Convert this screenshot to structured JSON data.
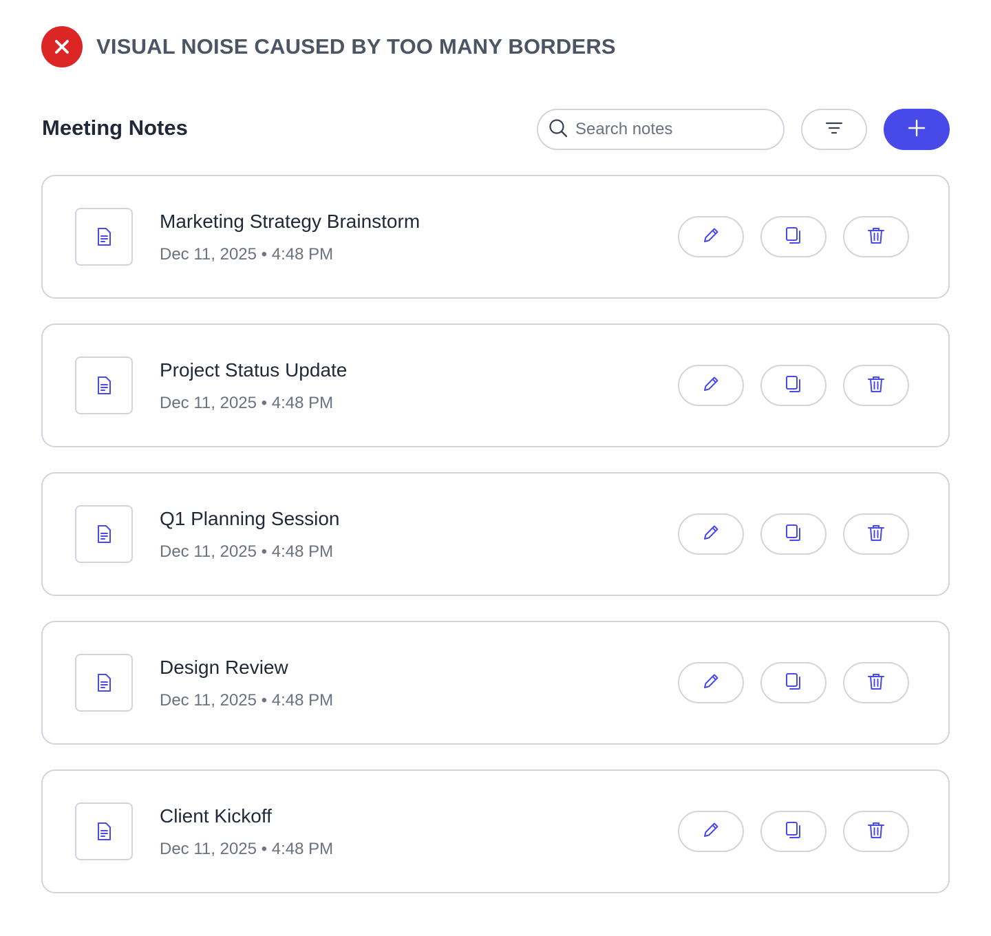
{
  "banner": {
    "text": "VISUAL NOISE CAUSED BY TOO MANY BORDERS",
    "icon": "x-circle-icon",
    "color": "#dc2626"
  },
  "header": {
    "title": "Meeting Notes",
    "search": {
      "placeholder": "Search notes",
      "value": ""
    },
    "filter_icon": "filter-icon",
    "add_icon": "plus-icon"
  },
  "colors": {
    "accent": "#4749e8",
    "border": "#d1d5db",
    "text": "#1f2937",
    "muted": "#6b7280"
  },
  "notes": [
    {
      "title": "Marketing Strategy Brainstorm",
      "meta": "Dec 11, 2025 • 4:48 PM"
    },
    {
      "title": "Project Status Update",
      "meta": "Dec 11, 2025 • 4:48 PM"
    },
    {
      "title": "Q1 Planning Session",
      "meta": "Dec 11, 2025 • 4:48 PM"
    },
    {
      "title": "Design Review",
      "meta": "Dec 11, 2025 • 4:48 PM"
    },
    {
      "title": "Client Kickoff",
      "meta": "Dec 11, 2025 • 4:48 PM"
    }
  ],
  "note_actions": [
    "edit-icon",
    "copy-icon",
    "trash-icon"
  ]
}
